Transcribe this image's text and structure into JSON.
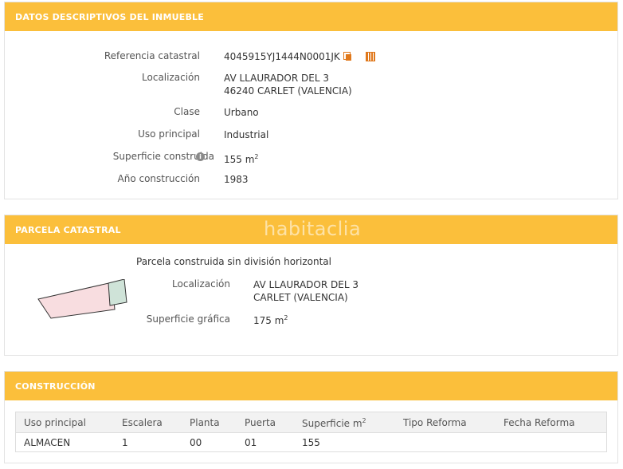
{
  "descriptivos": {
    "title": "DATOS DESCRIPTIVOS DEL INMUEBLE",
    "rows": [
      {
        "label": "Referencia catastral",
        "value": "4045915YJ1444N0001JK"
      },
      {
        "label": "Localización",
        "value": "AV LLAURADOR DEL 3",
        "value2": "46240 CARLET (VALENCIA)"
      },
      {
        "label": "Clase",
        "value": "Urbano"
      },
      {
        "label": "Uso principal",
        "value": "Industrial"
      },
      {
        "label": "Superficie construida",
        "value": "155 m",
        "unit_sup": "2"
      },
      {
        "label": "Año construcción",
        "value": "1983"
      }
    ],
    "icons": [
      "copy-icon",
      "grid-icon",
      "info-icon"
    ]
  },
  "parcela": {
    "title": "PARCELA CATASTRAL",
    "watermark": "habitaclia",
    "caption": "Parcela construida sin división horizontal",
    "localizacion_label": "Localización",
    "localizacion_line1": "AV LLAURADOR DEL 3",
    "localizacion_line2": "CARLET (VALENCIA)",
    "superficie_label": "Superficie gráfica",
    "superficie_value": "175 m",
    "superficie_sup": "2"
  },
  "construccion": {
    "title": "CONSTRUCCIÓN",
    "headers": [
      "Uso principal",
      "Escalera",
      "Planta",
      "Puerta",
      "Superficie m",
      "Tipo Reforma",
      "Fecha Reforma"
    ],
    "superficie_header_sup": "2",
    "rows": [
      [
        "ALMACEN",
        "1",
        "00",
        "01",
        "155",
        "",
        ""
      ]
    ]
  },
  "colors": {
    "header_bg": "#fbbf3b",
    "icon_accent": "#e0781b",
    "parcel_fill": "#f8dde0",
    "parcel_built": "#cfe3d8"
  }
}
